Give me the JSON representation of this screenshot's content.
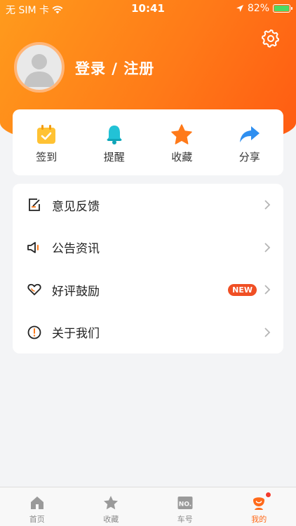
{
  "status": {
    "carrier": "无 SIM 卡",
    "time": "10:41",
    "battery": "82%"
  },
  "profile": {
    "login_label": "登录 / 注册"
  },
  "quick_actions": [
    {
      "label": "签到",
      "icon": "calendar-check-icon"
    },
    {
      "label": "提醒",
      "icon": "bell-icon"
    },
    {
      "label": "收藏",
      "icon": "star-icon"
    },
    {
      "label": "分享",
      "icon": "share-arrow-icon"
    }
  ],
  "menu": [
    {
      "label": "意见反馈",
      "icon": "edit-note-icon"
    },
    {
      "label": "公告资讯",
      "icon": "speaker-icon"
    },
    {
      "label": "好评鼓励",
      "icon": "heart-icon",
      "badge": "NEW"
    },
    {
      "label": "关于我们",
      "icon": "info-circle-icon"
    }
  ],
  "tabs": [
    {
      "label": "首页",
      "icon": "home-icon"
    },
    {
      "label": "收藏",
      "icon": "star-outline-icon"
    },
    {
      "label": "车号",
      "icon": "number-plate-icon"
    },
    {
      "label": "我的",
      "icon": "profile-icon",
      "active": true
    }
  ],
  "colors": {
    "accent": "#ff6a1a",
    "badge": "#f04f24",
    "background": "#f3f4f6"
  }
}
